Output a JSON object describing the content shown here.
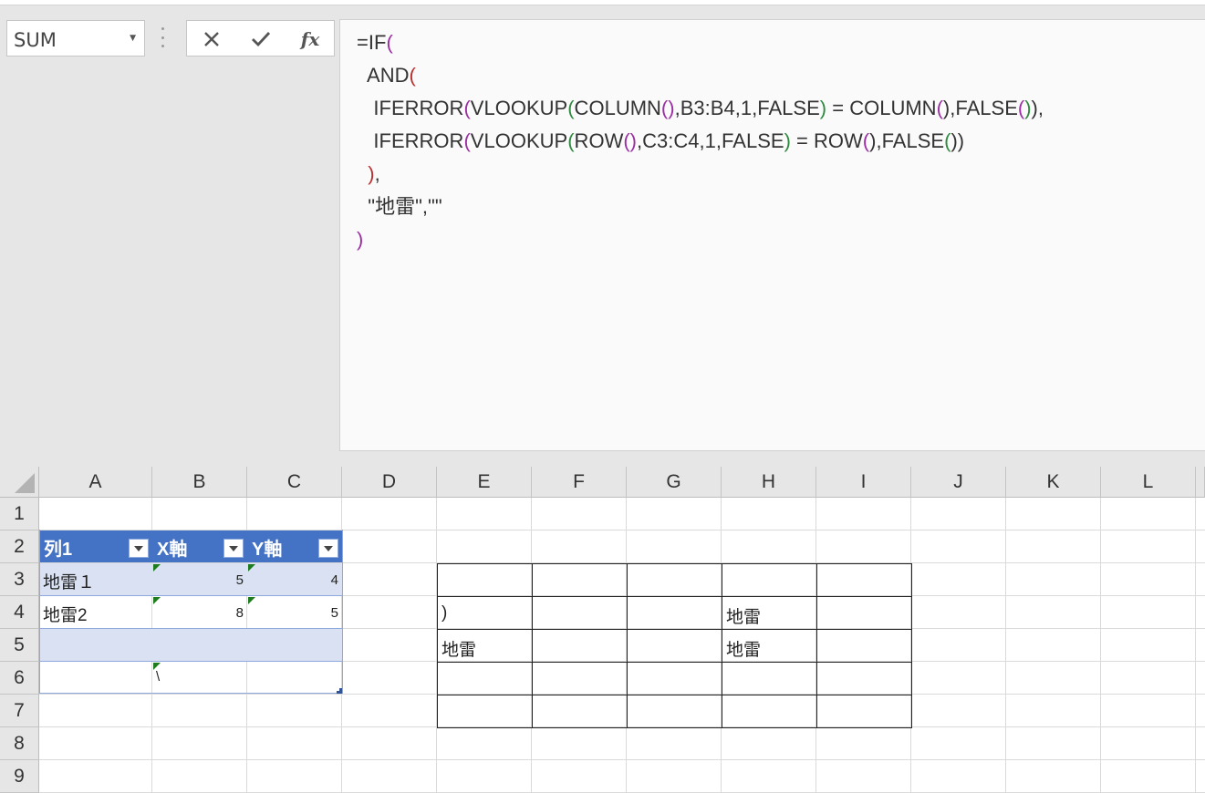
{
  "name_box": {
    "value": "SUM"
  },
  "formula_bar": {
    "cancel_icon": "close-icon",
    "enter_icon": "check-icon",
    "insert_function_label": "fx",
    "formula_lines": [
      "=IF(",
      "  AND(",
      "   IFERROR(VLOOKUP(COLUMN(),B3:B4,1,FALSE) = COLUMN(),FALSE()),",
      "   IFERROR(VLOOKUP(ROW(),C3:C4,1,FALSE) = ROW(),FALSE())",
      "  ),",
      "  \"地雷\",\"\"",
      ")"
    ]
  },
  "columns": [
    "A",
    "B",
    "C",
    "D",
    "E",
    "F",
    "G",
    "H",
    "I",
    "J",
    "K",
    "L"
  ],
  "rows": [
    "1",
    "2",
    "3",
    "4",
    "5",
    "6",
    "7",
    "8",
    "9"
  ],
  "table": {
    "headers": [
      "列1",
      "X軸",
      "Y軸"
    ],
    "rows": [
      {
        "col1": "地雷１",
        "x": "5",
        "y": "4"
      },
      {
        "col1": "地雷2",
        "x": "8",
        "y": "5"
      },
      {
        "col1": "",
        "x": "",
        "y": ""
      }
    ],
    "b6_value": "\\"
  },
  "grid_cells": {
    "E4": ")",
    "H4": "地雷",
    "E5": "地雷",
    "H5": "地雷"
  },
  "colors": {
    "table_header": "#4472c4",
    "table_band": "#d9e1f2",
    "error_indicator": "#1e7b1e"
  }
}
